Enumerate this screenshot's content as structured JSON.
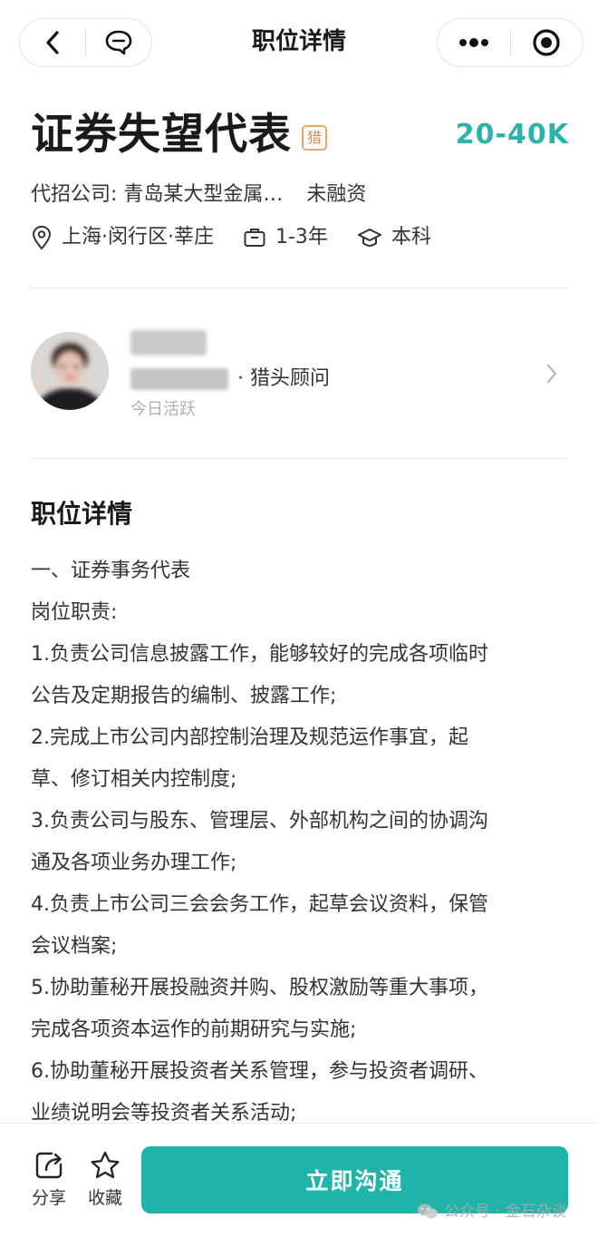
{
  "nav": {
    "title": "职位详情",
    "back_icon": "chevron-left-icon",
    "chat_icon": "message-bubble-icon",
    "more_icon": "more-dots-icon",
    "close_icon": "target-circle-icon"
  },
  "job": {
    "title": "证券失望代表",
    "badge": "猎",
    "salary": "20-40K",
    "company_label": "代招公司: 青岛某大型金属…",
    "funding": "未融资",
    "location": "上海·闵行区·莘庄",
    "experience": "1-3年",
    "education": "本科"
  },
  "recruiter": {
    "role": "· 猎头顾问",
    "active": "今日活跃"
  },
  "details": {
    "title": "职位详情",
    "lines": [
      "一、证券事务代表",
      "岗位职责:",
      "1.负责公司信息披露工作，能够较好的完成各项临时",
      "公告及定期报告的编制、披露工作;",
      "2.完成上市公司内部控制治理及规范运作事宜，起",
      "草、修订相关内控制度;",
      "3.负责公司与股东、管理层、外部机构之间的协调沟",
      "通及各项业务办理工作;",
      "4.负责上市公司三会会务工作，起草会议资料，保管",
      "会议档案;",
      "5.协助董秘开展投融资并购、股权激励等重大事项，",
      "完成各项资本运作的前期研究与实施;",
      "6.协助董秘开展投资者关系管理，参与投资者调研、",
      "业绩说明会等投资者关系活动;"
    ]
  },
  "bottom": {
    "share_label": "分享",
    "favorite_label": "收藏",
    "chat_button": "立即沟通"
  },
  "watermark": "公众号 · 金石杂谈",
  "colors": {
    "accent": "#1fb3a9",
    "salary": "#2ab3a8",
    "badge": "#e08b46"
  }
}
